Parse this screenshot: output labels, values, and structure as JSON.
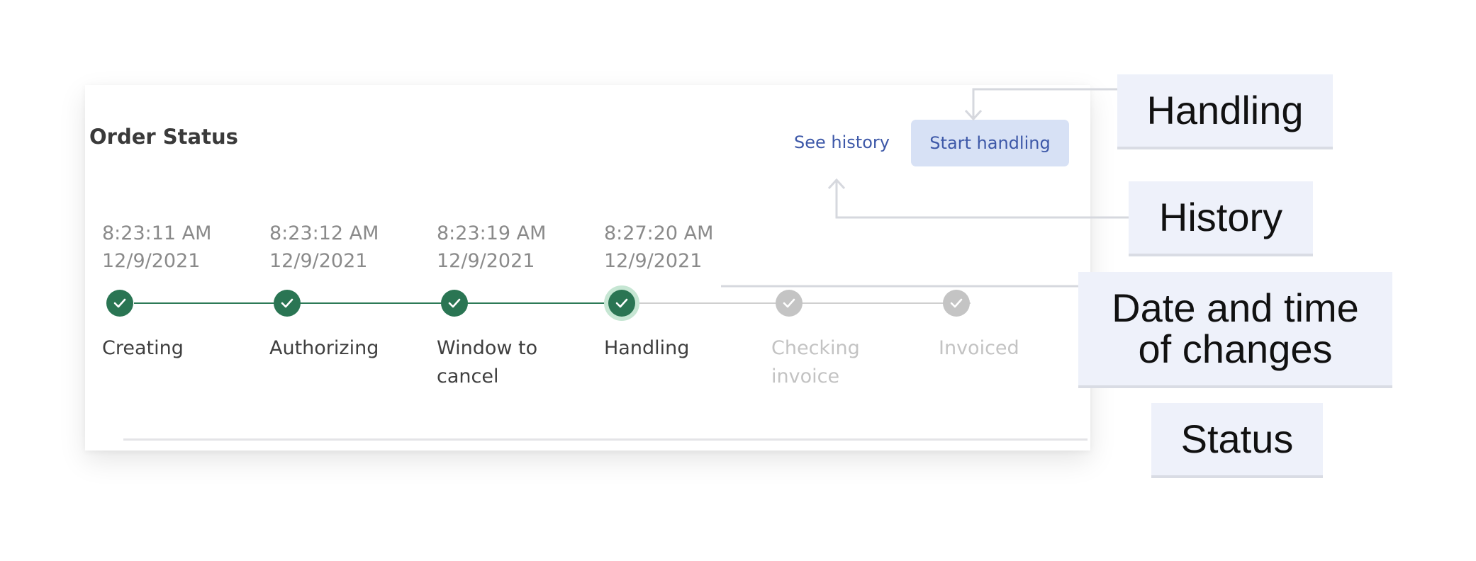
{
  "order_status": {
    "title": "Order Status",
    "see_history_label": "See history",
    "start_handling_label": "Start handling",
    "steps": [
      {
        "time": "8:23:11 AM",
        "date": "12/9/2021",
        "label": "Creating",
        "state": "done"
      },
      {
        "time": "8:23:12 AM",
        "date": "12/9/2021",
        "label": "Authorizing",
        "state": "done"
      },
      {
        "time": "8:23:19 AM",
        "date": "12/9/2021",
        "label": "Window to\ncancel",
        "state": "done"
      },
      {
        "time": "8:27:20 AM",
        "date": "12/9/2021",
        "label": "Handling",
        "state": "current"
      },
      {
        "time": "",
        "date": "",
        "label": "Checking\ninvoice",
        "state": "pending"
      },
      {
        "time": "",
        "date": "",
        "label": "Invoiced",
        "state": "pending"
      }
    ]
  },
  "callouts": {
    "handling": "Handling",
    "history": "History",
    "date_time": "Date and time\nof changes",
    "status": "Status"
  },
  "colors": {
    "completed": "#2a7553",
    "current_ring": "#c6e6d3",
    "pending": "#c4c4c4",
    "link": "#3d58a8",
    "button_bg": "#d7e1f5",
    "callout_bg": "#eef1fa"
  },
  "icons": {
    "step_done": "check-icon",
    "step_pending": "check-icon"
  }
}
